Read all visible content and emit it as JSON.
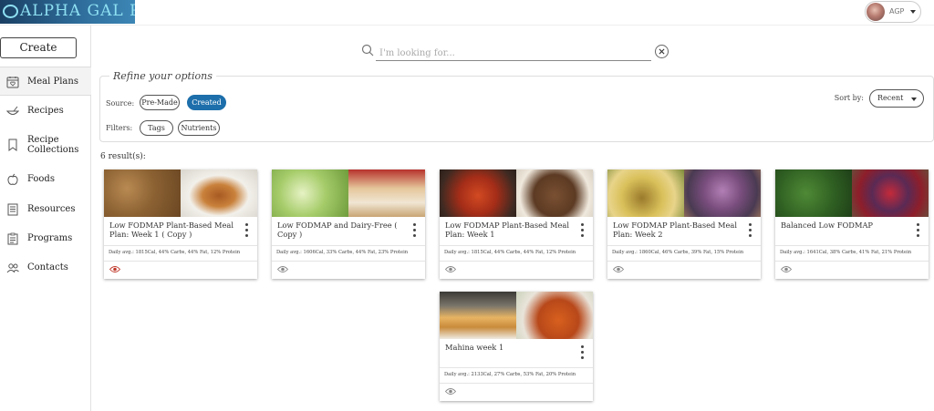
{
  "brand": {
    "logo_text": "ALPHA GAL PAL"
  },
  "user": {
    "initials": "AGP"
  },
  "sidebar": {
    "create_label": "Create",
    "items": [
      {
        "label": "Meal Plans",
        "icon": "calendar-heart-icon"
      },
      {
        "label": "Recipes",
        "icon": "mixing-bowl-icon"
      },
      {
        "label": "Recipe Collections",
        "icon": "bookmark-icon"
      },
      {
        "label": "Foods",
        "icon": "apple-icon"
      },
      {
        "label": "Resources",
        "icon": "document-icon"
      },
      {
        "label": "Programs",
        "icon": "clipboard-icon"
      },
      {
        "label": "Contacts",
        "icon": "people-icon"
      }
    ]
  },
  "search": {
    "placeholder": "I'm looking for..."
  },
  "refine": {
    "title": "Refine your options",
    "source_label": "Source:",
    "source_options": [
      "Pre-Made",
      "Created"
    ],
    "source_selected": "Created",
    "filters_label": "Filters:",
    "filter_options": [
      "Tags",
      "Nutrients"
    ],
    "sort_label": "Sort by:",
    "sort_value": "Recent"
  },
  "results": {
    "count_text": "6 result(s):",
    "cards": [
      {
        "title": "Low FODMAP Plant-Based Meal Plan: Week 1 ( Copy )",
        "stats": "Daily avg.:  1815Cal,  44% Carbs,  44% Fat,  12% Protein",
        "eye_color": "#c0392b"
      },
      {
        "title": "Low FODMAP and Dairy-Free ( Copy )",
        "stats": "Daily avg.:  1606Cal,  33% Carbs,  44% Fat,  23% Protein",
        "eye_color": "#888888"
      },
      {
        "title": "Low FODMAP Plant-Based Meal Plan: Week 1",
        "stats": "Daily avg.:  1815Cal,  44% Carbs,  44% Fat,  12% Protein",
        "eye_color": "#888888"
      },
      {
        "title": "Low FODMAP Plant-Based Meal Plan: Week 2",
        "stats": "Daily avg.:  1860Cal,  46% Carbs,  39% Fat,  15% Protein",
        "eye_color": "#888888"
      },
      {
        "title": "Balanced Low FODMAP",
        "stats": "Daily avg.:  1641Cal,  38% Carbs,  41% Fat,  21% Protein",
        "eye_color": "#888888"
      },
      {
        "title": "Mahina week 1",
        "stats": "Daily avg.:  2133Cal,  27% Carbs,  53% Fat,  20% Protein",
        "eye_color": "#888888"
      }
    ]
  },
  "colors": {
    "accent": "#1d6fab",
    "logo_bg": "#28507a",
    "logo_text": "#8ee0f2"
  }
}
